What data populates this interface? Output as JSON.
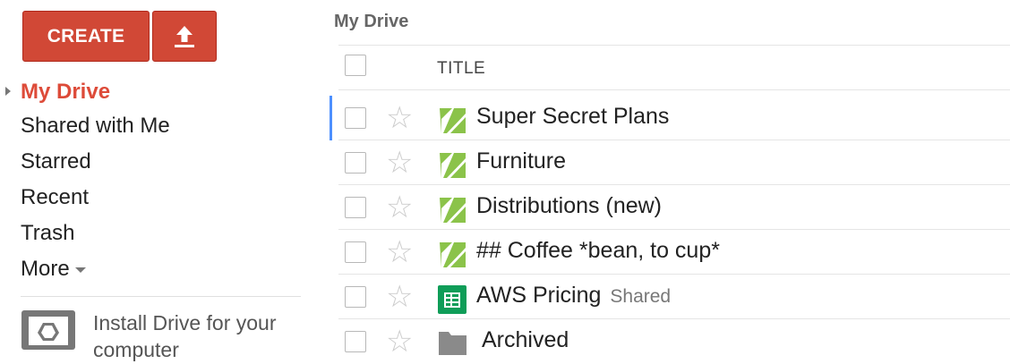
{
  "sidebar": {
    "create_label": "CREATE",
    "upload_icon": "upload-arrow-icon",
    "nav": [
      {
        "label": "My Drive",
        "active": true
      },
      {
        "label": "Shared with Me"
      },
      {
        "label": "Starred"
      },
      {
        "label": "Recent"
      },
      {
        "label": "Trash"
      },
      {
        "label": "More"
      }
    ],
    "install_text": "Install Drive for your computer"
  },
  "main": {
    "title": "My Drive",
    "column_title": "TITLE",
    "rows": [
      {
        "name": "Super Secret Plans",
        "icon": "stackedit-doc-icon"
      },
      {
        "name": "Furniture",
        "icon": "stackedit-doc-icon"
      },
      {
        "name": "Distributions (new)",
        "icon": "stackedit-doc-icon"
      },
      {
        "name": "## Coffee *bean, to cup*",
        "icon": "stackedit-doc-icon"
      },
      {
        "name": "AWS Pricing",
        "icon": "spreadsheet-icon",
        "badge": "Shared"
      },
      {
        "name": "Archived",
        "icon": "folder-icon"
      }
    ]
  },
  "colors": {
    "accent": "#d14836",
    "active_nav": "#dd4b39",
    "selection_bar": "#4d90fe",
    "doc_icon_green": "#8bc34a",
    "sheet_icon_green": "#0f9d58"
  }
}
